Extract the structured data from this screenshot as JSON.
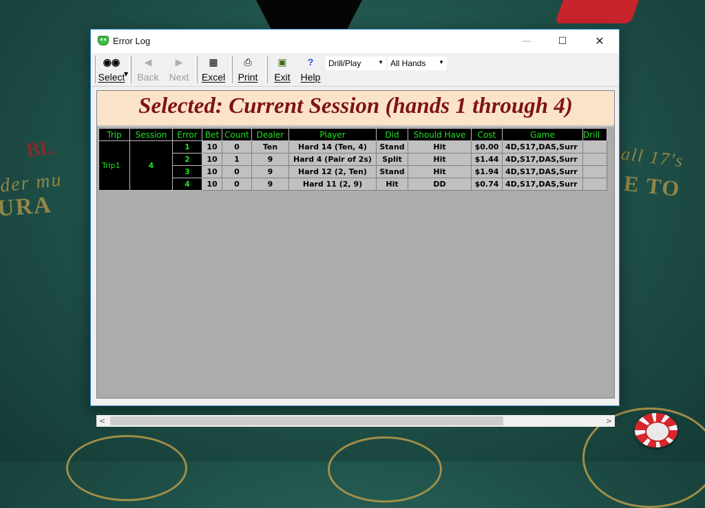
{
  "window": {
    "title": "Error Log",
    "controls": {
      "minimize": "—",
      "maximize": "☐",
      "close": "✕"
    }
  },
  "toolbar": {
    "buttons": [
      {
        "label": "Select",
        "icon": "binoculars-icon",
        "glyph": "👓",
        "enabled": true
      },
      {
        "label": "Back",
        "icon": "arrow-left-icon",
        "glyph": "◀",
        "enabled": false
      },
      {
        "label": "Next",
        "icon": "arrow-right-icon",
        "glyph": "▶",
        "enabled": false
      },
      {
        "label": "Excel",
        "icon": "excel-icon",
        "glyph": "▦",
        "enabled": true
      },
      {
        "label": "Print",
        "icon": "printer-icon",
        "glyph": "🖶",
        "enabled": true
      },
      {
        "label": "Exit",
        "icon": "exit-icon",
        "glyph": "⏏",
        "enabled": true
      },
      {
        "label": "Help",
        "icon": "help-icon",
        "glyph": "?",
        "enabled": true
      }
    ],
    "mode_select": {
      "value": "Drill/Play"
    },
    "hands_select": {
      "value": "All Hands"
    }
  },
  "banner": {
    "text": "Selected: Current Session (hands 1 through 4)"
  },
  "grid": {
    "columns": [
      "Trip",
      "Session",
      "Error",
      "Bet",
      "Count",
      "Dealer",
      "Player",
      "Did",
      "Should Have",
      "Cost",
      "Game",
      "Drill"
    ],
    "trip": "Trip1",
    "session": "4",
    "rows": [
      {
        "error": "1",
        "bet": "10",
        "count": "0",
        "dealer": "Ten",
        "player": "Hard 14 (Ten, 4)",
        "did": "Stand",
        "should": "Hit",
        "cost": "$0.00",
        "game": "4D,S17,DAS,Surr",
        "drill": ""
      },
      {
        "error": "2",
        "bet": "10",
        "count": "1",
        "dealer": "9",
        "player": "Hard 4 (Pair of 2s)",
        "did": "Split",
        "should": "Hit",
        "cost": "$1.44",
        "game": "4D,S17,DAS,Surr",
        "drill": ""
      },
      {
        "error": "3",
        "bet": "10",
        "count": "0",
        "dealer": "9",
        "player": "Hard 12 (2, Ten)",
        "did": "Stand",
        "should": "Hit",
        "cost": "$1.94",
        "game": "4D,S17,DAS,Surr",
        "drill": ""
      },
      {
        "error": "4",
        "bet": "10",
        "count": "0",
        "dealer": "9",
        "player": "Hard 11 (2, 9)",
        "did": "Hit",
        "should": "DD",
        "cost": "$0.74",
        "game": "4D,S17,DAS,Surr",
        "drill": ""
      }
    ]
  },
  "scrollbar": {
    "left_arrow": "<",
    "right_arrow": ">"
  },
  "background": {
    "felt_red_text": "BL",
    "felt_left_line1": "der mu",
    "felt_left_line2": "URA",
    "felt_right_line1": "all 17's",
    "felt_right_line2": "E TO"
  },
  "colors": {
    "accent": "#21e021",
    "banner_text": "#7d1414",
    "banner_bg": "#fbe3c9",
    "felt": "#1e5048"
  }
}
